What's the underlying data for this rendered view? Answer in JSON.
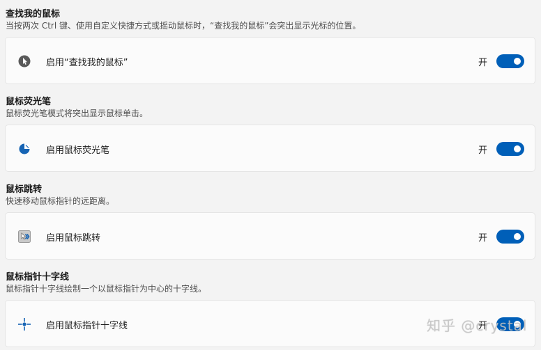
{
  "sections": [
    {
      "title": "查找我的鼠标",
      "description": "当按两次 Ctrl 键、使用自定义快捷方式或摇动鼠标时，“查找我的鼠标”会突出显示光标的位置。",
      "setting_label": "启用“查找我的鼠标”",
      "state_label": "开",
      "enabled": true,
      "icon": "find-mouse-icon"
    },
    {
      "title": "鼠标荧光笔",
      "description": "鼠标荧光笔模式将突出显示鼠标单击。",
      "setting_label": "启用鼠标荧光笔",
      "state_label": "开",
      "enabled": true,
      "icon": "highlighter-icon"
    },
    {
      "title": "鼠标跳转",
      "description": "快速移动鼠标指针的远距离。",
      "setting_label": "启用鼠标跳转",
      "state_label": "开",
      "enabled": true,
      "icon": "mouse-jump-icon"
    },
    {
      "title": "鼠标指针十字线",
      "description": "鼠标指针十字线绘制一个以鼠标指针为中心的十字线。",
      "setting_label": "启用鼠标指针十字线",
      "state_label": "开",
      "enabled": true,
      "icon": "crosshairs-icon"
    }
  ],
  "watermark": "知乎 @crystal",
  "colors": {
    "accent": "#005fb8",
    "background": "#f3f3f3",
    "card": "#fbfbfb"
  }
}
